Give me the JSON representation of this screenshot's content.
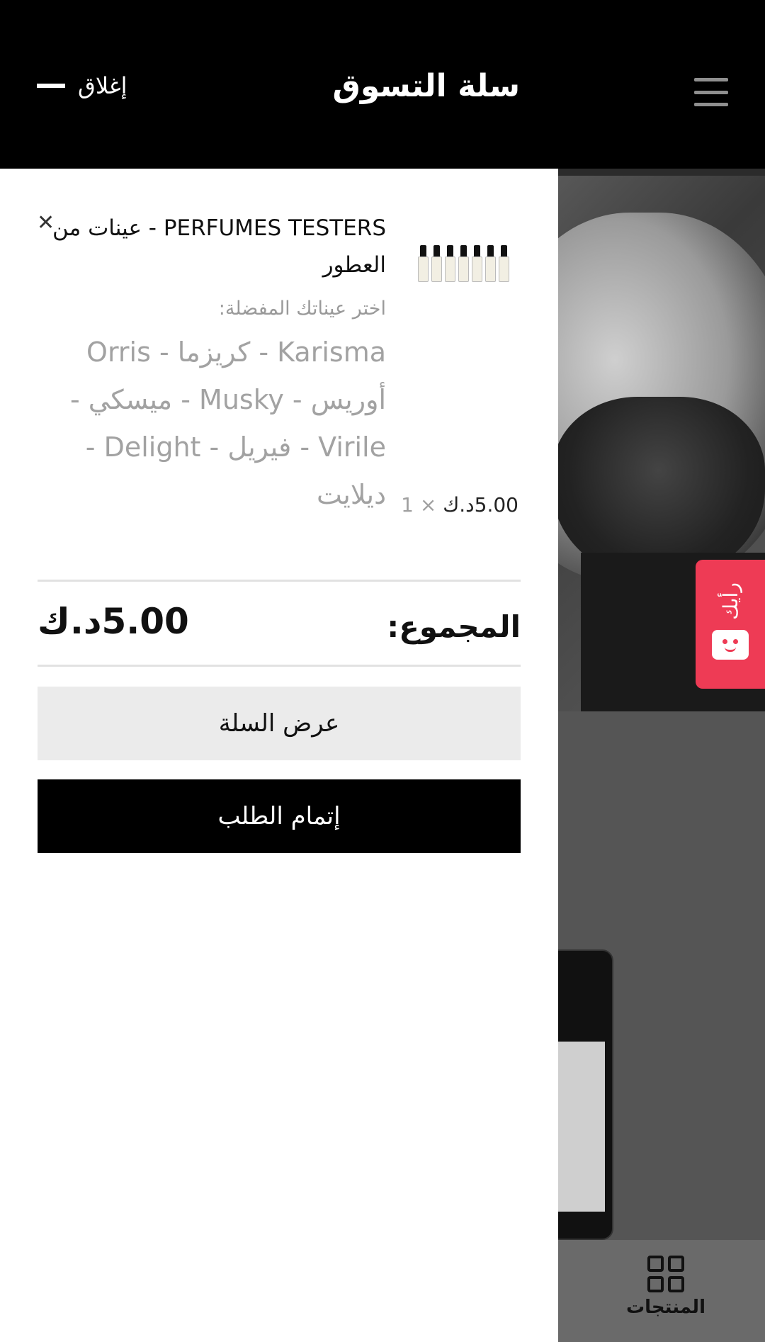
{
  "header": {
    "title": "سلة التسوق",
    "close_label": "إغلاق",
    "menu_icon": "hamburger-icon"
  },
  "cart": {
    "items": [
      {
        "title": "PERFUMES TESTERS - عينات من العطور",
        "variation_label": "اختر عيناتك المفضلة:",
        "variation_value": "Karisma - كريزما - Orris أوريس - Musky - ميسكي - Virile - فيريل - Delight - ديلايت",
        "quantity": "1",
        "multiplier": "×",
        "price": "5.00د.ك"
      }
    ],
    "total_label": "المجموع:",
    "total_value": "5.00د.ك",
    "view_cart_label": "عرض السلة",
    "checkout_label": "إتمام الطلب"
  },
  "feedback": {
    "label": "رأيك"
  },
  "bottom_nav": {
    "products_label": "المنتجات",
    "products_icon": "grid-icon"
  },
  "colors": {
    "header_bg": "#000000",
    "feedback_accent": "#ee3b55",
    "checkout_bg": "#000000",
    "view_cart_bg": "#ebebeb"
  }
}
